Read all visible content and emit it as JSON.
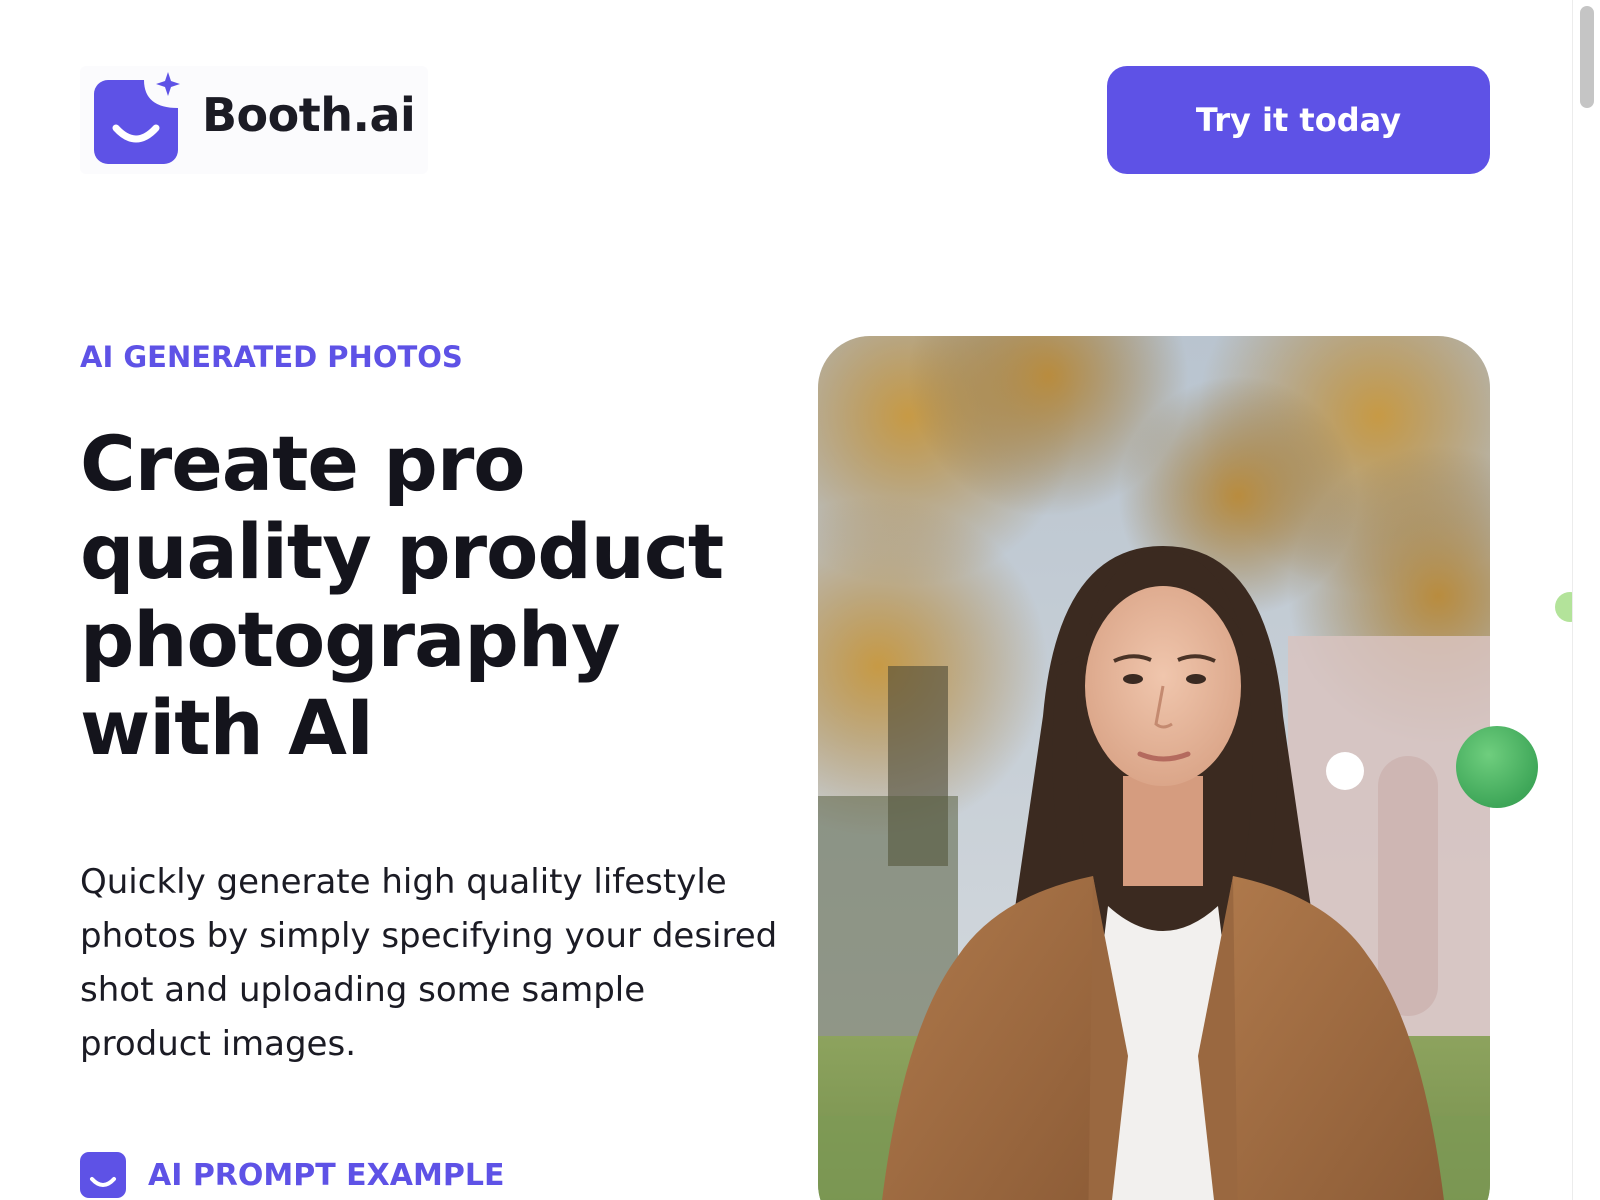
{
  "header": {
    "logo_text": "Booth.ai",
    "cta_label": "Try it today"
  },
  "hero": {
    "eyebrow": "AI GENERATED PHOTOS",
    "title_lines": [
      "Create pro",
      "quality product",
      "photography",
      "with AI"
    ],
    "description": "Quickly generate high quality lifestyle photos by simply specifying your desired shot and uploading some sample product images.",
    "prompt_label": "AI PROMPT EXAMPLE"
  },
  "icons": {
    "logo": "smile-bag-sparkle-icon",
    "prompt": "smile-bag-icon"
  },
  "colors": {
    "accent": "#5e52e6",
    "text": "#14141c",
    "green_dot": "#3fa759",
    "light_green_dot": "#b3e39a"
  }
}
